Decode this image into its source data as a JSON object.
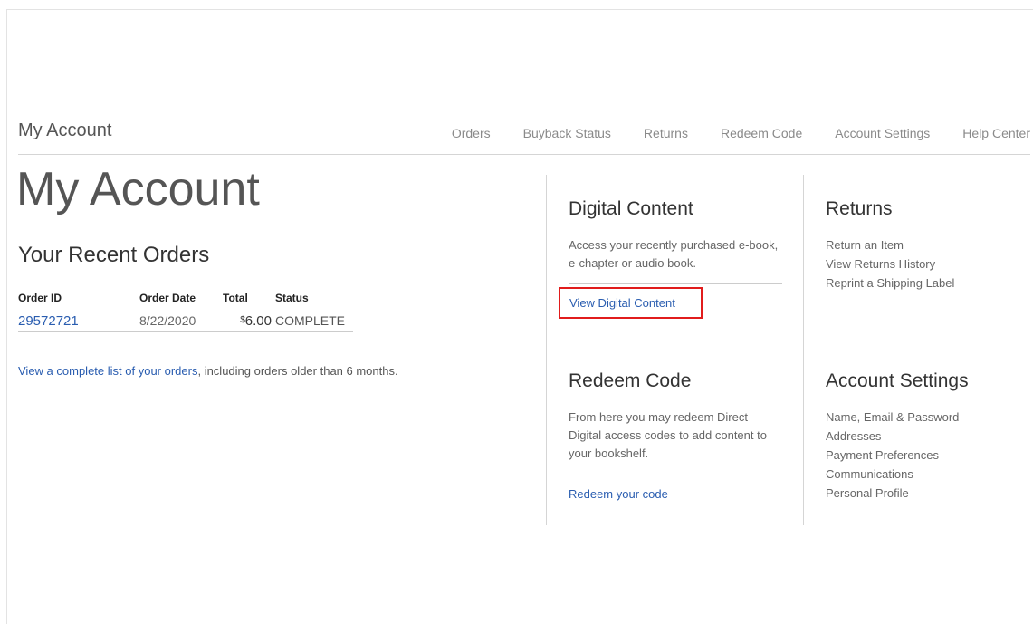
{
  "header": {
    "brand": "My Account",
    "nav": [
      "Orders",
      "Buyback Status",
      "Returns",
      "Redeem Code",
      "Account Settings",
      "Help Center"
    ]
  },
  "page_title": "My Account",
  "recent_orders": {
    "title": "Your Recent Orders",
    "columns": [
      "Order ID",
      "Order Date",
      "Total",
      "Status"
    ],
    "rows": [
      {
        "order_id": "29572721",
        "date": "8/22/2020",
        "currency": "$",
        "total": "6.00",
        "status": "COMPLETE"
      }
    ],
    "complete_list_link": "View a complete list of your orders",
    "complete_list_suffix": ", including orders older than 6 months."
  },
  "digital_content": {
    "title": "Digital Content",
    "text": "Access your recently purchased e-book, e-chapter or audio book.",
    "link": "View Digital Content",
    "highlight_color": "#e11c1c"
  },
  "redeem_code": {
    "title": "Redeem Code",
    "text": "From here you may redeem Direct Digital access codes to add content to your bookshelf.",
    "link": "Redeem your code"
  },
  "returns": {
    "title": "Returns",
    "items": [
      "Return an Item",
      "View Returns History",
      "Reprint a Shipping Label"
    ]
  },
  "account_settings": {
    "title": "Account Settings",
    "items": [
      "Name, Email & Password",
      "Addresses",
      "Payment Preferences",
      "Communications",
      "Personal Profile"
    ]
  },
  "colors": {
    "link": "#2a5db0",
    "text": "#555555",
    "border": "#d5d5d5"
  }
}
